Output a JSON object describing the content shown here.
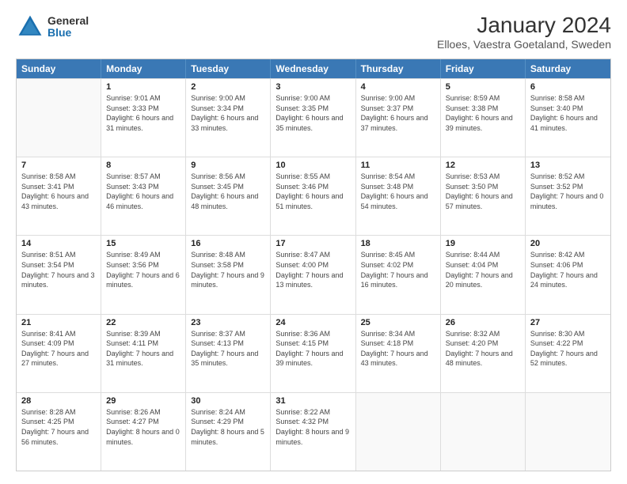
{
  "header": {
    "logo_general": "General",
    "logo_blue": "Blue",
    "title": "January 2024",
    "subtitle": "Elloes, Vaestra Goetaland, Sweden"
  },
  "weekdays": [
    "Sunday",
    "Monday",
    "Tuesday",
    "Wednesday",
    "Thursday",
    "Friday",
    "Saturday"
  ],
  "rows": [
    [
      {
        "day": "",
        "empty": true
      },
      {
        "day": "1",
        "sunrise": "Sunrise: 9:01 AM",
        "sunset": "Sunset: 3:33 PM",
        "daylight": "Daylight: 6 hours and 31 minutes."
      },
      {
        "day": "2",
        "sunrise": "Sunrise: 9:00 AM",
        "sunset": "Sunset: 3:34 PM",
        "daylight": "Daylight: 6 hours and 33 minutes."
      },
      {
        "day": "3",
        "sunrise": "Sunrise: 9:00 AM",
        "sunset": "Sunset: 3:35 PM",
        "daylight": "Daylight: 6 hours and 35 minutes."
      },
      {
        "day": "4",
        "sunrise": "Sunrise: 9:00 AM",
        "sunset": "Sunset: 3:37 PM",
        "daylight": "Daylight: 6 hours and 37 minutes."
      },
      {
        "day": "5",
        "sunrise": "Sunrise: 8:59 AM",
        "sunset": "Sunset: 3:38 PM",
        "daylight": "Daylight: 6 hours and 39 minutes."
      },
      {
        "day": "6",
        "sunrise": "Sunrise: 8:58 AM",
        "sunset": "Sunset: 3:40 PM",
        "daylight": "Daylight: 6 hours and 41 minutes."
      }
    ],
    [
      {
        "day": "7",
        "sunrise": "Sunrise: 8:58 AM",
        "sunset": "Sunset: 3:41 PM",
        "daylight": "Daylight: 6 hours and 43 minutes."
      },
      {
        "day": "8",
        "sunrise": "Sunrise: 8:57 AM",
        "sunset": "Sunset: 3:43 PM",
        "daylight": "Daylight: 6 hours and 46 minutes."
      },
      {
        "day": "9",
        "sunrise": "Sunrise: 8:56 AM",
        "sunset": "Sunset: 3:45 PM",
        "daylight": "Daylight: 6 hours and 48 minutes."
      },
      {
        "day": "10",
        "sunrise": "Sunrise: 8:55 AM",
        "sunset": "Sunset: 3:46 PM",
        "daylight": "Daylight: 6 hours and 51 minutes."
      },
      {
        "day": "11",
        "sunrise": "Sunrise: 8:54 AM",
        "sunset": "Sunset: 3:48 PM",
        "daylight": "Daylight: 6 hours and 54 minutes."
      },
      {
        "day": "12",
        "sunrise": "Sunrise: 8:53 AM",
        "sunset": "Sunset: 3:50 PM",
        "daylight": "Daylight: 6 hours and 57 minutes."
      },
      {
        "day": "13",
        "sunrise": "Sunrise: 8:52 AM",
        "sunset": "Sunset: 3:52 PM",
        "daylight": "Daylight: 7 hours and 0 minutes."
      }
    ],
    [
      {
        "day": "14",
        "sunrise": "Sunrise: 8:51 AM",
        "sunset": "Sunset: 3:54 PM",
        "daylight": "Daylight: 7 hours and 3 minutes."
      },
      {
        "day": "15",
        "sunrise": "Sunrise: 8:49 AM",
        "sunset": "Sunset: 3:56 PM",
        "daylight": "Daylight: 7 hours and 6 minutes."
      },
      {
        "day": "16",
        "sunrise": "Sunrise: 8:48 AM",
        "sunset": "Sunset: 3:58 PM",
        "daylight": "Daylight: 7 hours and 9 minutes."
      },
      {
        "day": "17",
        "sunrise": "Sunrise: 8:47 AM",
        "sunset": "Sunset: 4:00 PM",
        "daylight": "Daylight: 7 hours and 13 minutes."
      },
      {
        "day": "18",
        "sunrise": "Sunrise: 8:45 AM",
        "sunset": "Sunset: 4:02 PM",
        "daylight": "Daylight: 7 hours and 16 minutes."
      },
      {
        "day": "19",
        "sunrise": "Sunrise: 8:44 AM",
        "sunset": "Sunset: 4:04 PM",
        "daylight": "Daylight: 7 hours and 20 minutes."
      },
      {
        "day": "20",
        "sunrise": "Sunrise: 8:42 AM",
        "sunset": "Sunset: 4:06 PM",
        "daylight": "Daylight: 7 hours and 24 minutes."
      }
    ],
    [
      {
        "day": "21",
        "sunrise": "Sunrise: 8:41 AM",
        "sunset": "Sunset: 4:09 PM",
        "daylight": "Daylight: 7 hours and 27 minutes."
      },
      {
        "day": "22",
        "sunrise": "Sunrise: 8:39 AM",
        "sunset": "Sunset: 4:11 PM",
        "daylight": "Daylight: 7 hours and 31 minutes."
      },
      {
        "day": "23",
        "sunrise": "Sunrise: 8:37 AM",
        "sunset": "Sunset: 4:13 PM",
        "daylight": "Daylight: 7 hours and 35 minutes."
      },
      {
        "day": "24",
        "sunrise": "Sunrise: 8:36 AM",
        "sunset": "Sunset: 4:15 PM",
        "daylight": "Daylight: 7 hours and 39 minutes."
      },
      {
        "day": "25",
        "sunrise": "Sunrise: 8:34 AM",
        "sunset": "Sunset: 4:18 PM",
        "daylight": "Daylight: 7 hours and 43 minutes."
      },
      {
        "day": "26",
        "sunrise": "Sunrise: 8:32 AM",
        "sunset": "Sunset: 4:20 PM",
        "daylight": "Daylight: 7 hours and 48 minutes."
      },
      {
        "day": "27",
        "sunrise": "Sunrise: 8:30 AM",
        "sunset": "Sunset: 4:22 PM",
        "daylight": "Daylight: 7 hours and 52 minutes."
      }
    ],
    [
      {
        "day": "28",
        "sunrise": "Sunrise: 8:28 AM",
        "sunset": "Sunset: 4:25 PM",
        "daylight": "Daylight: 7 hours and 56 minutes."
      },
      {
        "day": "29",
        "sunrise": "Sunrise: 8:26 AM",
        "sunset": "Sunset: 4:27 PM",
        "daylight": "Daylight: 8 hours and 0 minutes."
      },
      {
        "day": "30",
        "sunrise": "Sunrise: 8:24 AM",
        "sunset": "Sunset: 4:29 PM",
        "daylight": "Daylight: 8 hours and 5 minutes."
      },
      {
        "day": "31",
        "sunrise": "Sunrise: 8:22 AM",
        "sunset": "Sunset: 4:32 PM",
        "daylight": "Daylight: 8 hours and 9 minutes."
      },
      {
        "day": "",
        "empty": true
      },
      {
        "day": "",
        "empty": true
      },
      {
        "day": "",
        "empty": true
      }
    ]
  ]
}
